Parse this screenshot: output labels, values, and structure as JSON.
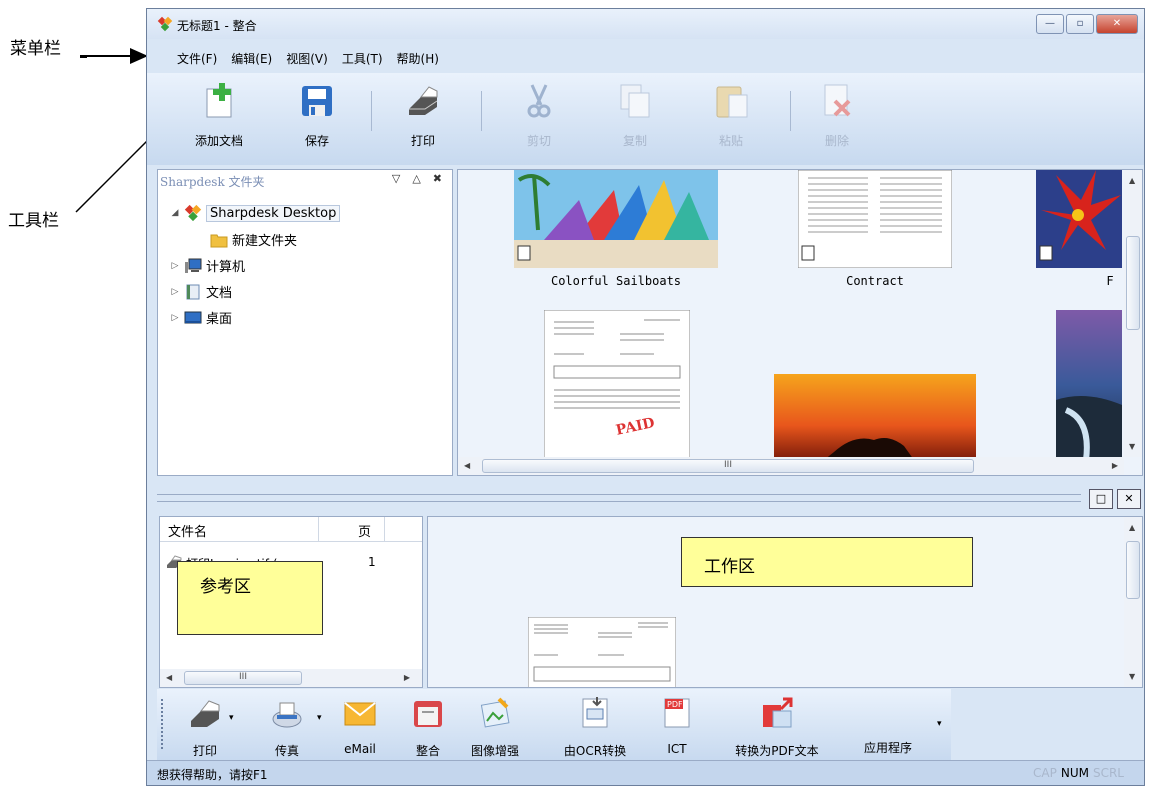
{
  "annotations": {
    "menubar_label": "菜单栏",
    "toolbar_label": "工具栏",
    "reference_label": "参考区",
    "work_label": "工作区"
  },
  "window": {
    "title": "无标题1 - 整合",
    "minimize": "—",
    "maximize": "▫",
    "close": "✕"
  },
  "menu": {
    "items": [
      "文件(F)",
      "编辑(E)",
      "视图(V)",
      "工具(T)",
      "帮助(H)"
    ]
  },
  "toolbar": {
    "buttons": [
      {
        "label": "添加文档",
        "icon": "add-document-icon",
        "enabled": true
      },
      {
        "label": "保存",
        "icon": "save-icon",
        "enabled": true
      },
      {
        "label": "打印",
        "icon": "printer-icon",
        "enabled": true
      },
      {
        "label": "剪切",
        "icon": "cut-icon",
        "enabled": false
      },
      {
        "label": "复制",
        "icon": "copy-icon",
        "enabled": false
      },
      {
        "label": "粘贴",
        "icon": "paste-icon",
        "enabled": false
      },
      {
        "label": "删除",
        "icon": "delete-icon",
        "enabled": false
      }
    ]
  },
  "folder_panel": {
    "title": "Sharpdesk 文件夹",
    "controls": [
      "▽",
      "△",
      "✖"
    ],
    "tree": [
      {
        "label": "Sharpdesk Desktop",
        "expander": "◢",
        "icon": "sharpdesk-icon",
        "selected": true
      },
      {
        "label": "新建文件夹",
        "expander": "",
        "icon": "folder-icon"
      },
      {
        "label": "计算机",
        "expander": "▷",
        "icon": "computer-icon"
      },
      {
        "label": "文档",
        "expander": "▷",
        "icon": "documents-icon"
      },
      {
        "label": "桌面",
        "expander": "▷",
        "icon": "desktop-icon"
      }
    ]
  },
  "thumbnails": {
    "captions": [
      "Colorful Sailboats",
      "Contract",
      "F"
    ],
    "paid_stamp": "PAID",
    "hscroll_grip": "III"
  },
  "splitter": {
    "restore": "□",
    "close": "✕"
  },
  "reference": {
    "col_filename": "文件名",
    "col_pages": "页",
    "row_filename": "打印Invoice.tif (",
    "row_pages": "1",
    "hscroll_grip": "III"
  },
  "bottom_toolbar": {
    "buttons": [
      {
        "label": "打印",
        "icon": "printer-icon"
      },
      {
        "label": "传真",
        "icon": "fax-icon"
      },
      {
        "label": "eMail",
        "icon": "email-icon"
      },
      {
        "label": "整合",
        "icon": "combine-icon"
      },
      {
        "label": "图像增强",
        "icon": "image-enhance-icon"
      },
      {
        "label": "由OCR转换",
        "icon": "ocr-icon"
      },
      {
        "label": "ICT",
        "icon": "pdf-ict-icon"
      },
      {
        "label": "转换为PDF文本",
        "icon": "convert-pdf-icon"
      },
      {
        "label": "应用程序",
        "icon": "applications-icon"
      }
    ]
  },
  "status": {
    "text": "想获得帮助，请按F1",
    "keys": [
      "CAP",
      "NUM",
      "SCRL"
    ],
    "active_key": "NUM"
  }
}
